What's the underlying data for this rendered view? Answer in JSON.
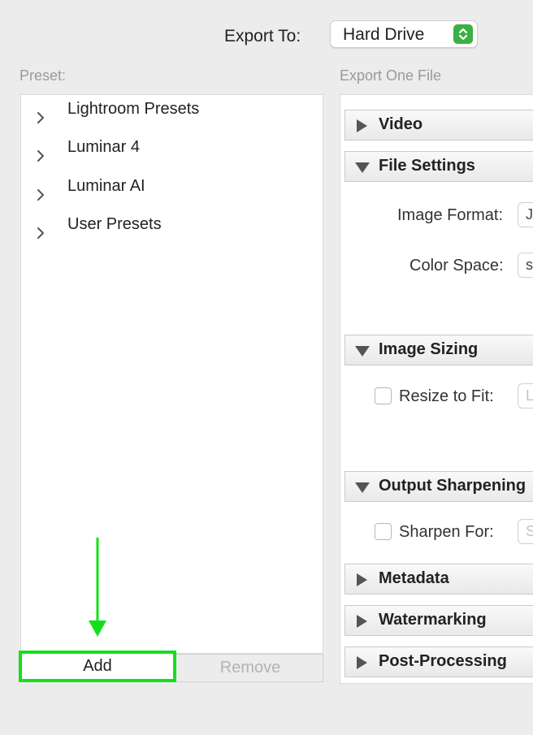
{
  "header": {
    "export_to_label": "Export To:",
    "export_to_value": "Hard Drive"
  },
  "preset_panel": {
    "label": "Preset:",
    "items": [
      {
        "label": "Lightroom Presets",
        "icon": "chevron-right-icon"
      },
      {
        "label": "Luminar 4",
        "icon": "chevron-right-icon"
      },
      {
        "label": "Luminar AI",
        "icon": "chevron-right-icon"
      },
      {
        "label": "User Presets",
        "icon": "chevron-right-icon"
      }
    ],
    "add_label": "Add",
    "remove_label": "Remove"
  },
  "export_panel": {
    "label": "Export One File",
    "sections": {
      "video": "Video",
      "file_settings": "File Settings",
      "image_sizing": "Image Sizing",
      "output_sharpening": "Output Sharpening",
      "metadata": "Metadata",
      "watermarking": "Watermarking",
      "post_processing": "Post-Processing"
    },
    "image_format_label": "Image Format:",
    "image_format_value": "J",
    "color_space_label": "Color Space:",
    "color_space_value": "s",
    "resize_to_fit_label": "Resize to Fit:",
    "resize_to_fit_value": "L",
    "sharpen_for_label": "Sharpen For:",
    "sharpen_for_value": "S"
  },
  "colors": {
    "highlight": "#13e01a",
    "select_accent": "#3cb043"
  }
}
